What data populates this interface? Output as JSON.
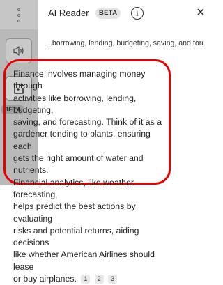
{
  "rail": {
    "speaker_icon": "speaker-icon",
    "ai_reader_icon": "ai-sparkle-doc-icon",
    "beta_label": "BETA"
  },
  "header": {
    "title": "AI Reader",
    "badge": "BETA",
    "info_glyph": "i",
    "close_glyph": "×"
  },
  "topics": "..borrowing, lending, budgeting, saving, and fore...",
  "summary": {
    "lines": [
      "Finance involves managing money through",
      "activities like borrowing, lending, budgeting,",
      "saving, and forecasting. Think of it as a",
      "gardener tending to plants, ensuring each",
      "gets the right amount of water and nutrients.",
      "Financial analytics, like weather forecasting,",
      "helps predict the best actions by evaluating",
      "risks and potential returns, aiding decisions",
      "like whether American Airlines should lease",
      "or buy airplanes."
    ],
    "citations": [
      "1",
      "2",
      "3"
    ]
  },
  "colors": {
    "highlight_border": "#e60000",
    "rail_bg": "#b9b9b9"
  }
}
